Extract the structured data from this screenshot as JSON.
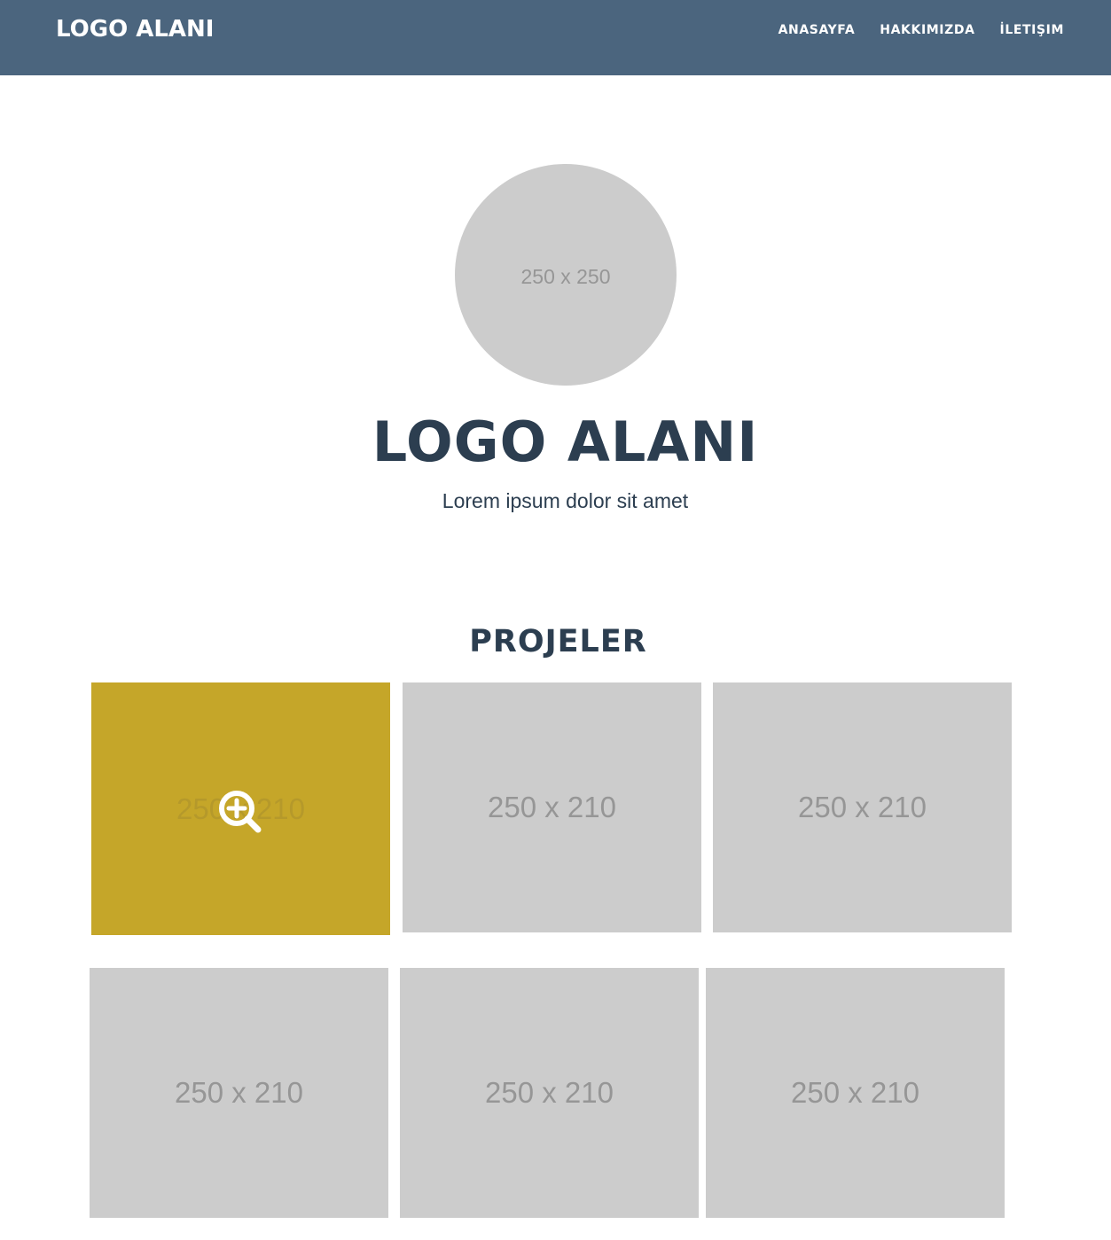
{
  "navbar": {
    "brand": "LOGO ALANI",
    "links": [
      "ANASAYFA",
      "HAKKIMIZDA",
      "İLETIŞIM"
    ],
    "background_color": "#4b657e"
  },
  "hero": {
    "avatar_placeholder": "250 x 250",
    "title": "LOGO ALANI",
    "subtitle": "Lorem ipsum dolor sit amet"
  },
  "projects": {
    "title": "PROJELER",
    "items": [
      {
        "placeholder": "250 x 210",
        "hovered": true
      },
      {
        "placeholder": "250 x 210",
        "hovered": false
      },
      {
        "placeholder": "250 x 210",
        "hovered": false
      },
      {
        "placeholder": "250 x 210",
        "hovered": false
      },
      {
        "placeholder": "250 x 210",
        "hovered": false
      },
      {
        "placeholder": "250 x 210",
        "hovered": false
      }
    ],
    "hover_color": "#c5a629",
    "hover_icon": "zoom-in-icon"
  },
  "colors": {
    "heading": "#2c3e50",
    "placeholder_bg": "#cccccc"
  }
}
